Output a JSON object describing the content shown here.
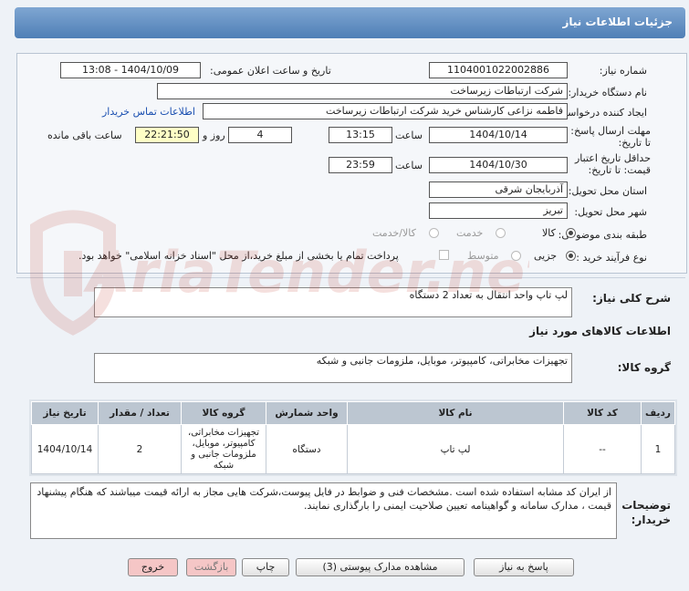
{
  "header": {
    "title": "جزئیات اطلاعات نیاز"
  },
  "form": {
    "need_number_label": "شماره نیاز:",
    "need_number": "1104001022002886",
    "announce_label": "تاریخ و ساعت اعلان عمومی:",
    "announce_value": "1404/10/09 - 13:08",
    "buyer_org_label": "نام دستگاه خریدار:",
    "buyer_org": "شرکت ارتباطات زیرساخت",
    "requester_label": "ایجاد کننده درخواست:",
    "requester": "فاطمه نزاعی کارشناس خرید شرکت ارتباطات زیرساخت",
    "contact_link": "اطلاعات تماس خریدار",
    "reply_deadline_label": "مهلت ارسال پاسخ: تا تاریخ:",
    "reply_date": "1404/10/14",
    "time_label": "ساعت",
    "reply_time": "13:15",
    "days_value": "4",
    "days_label": "روز و",
    "remaining_time": "22:21:50",
    "remaining_label": "ساعت باقی مانده",
    "price_validity_label": "حداقل تاریخ اعتبار قیمت: تا تاریخ:",
    "price_date": "1404/10/30",
    "price_time": "23:59",
    "province_label": "استان محل تحویل:",
    "province": "آذربایجان شرقی",
    "city_label": "شهر محل تحویل:",
    "city": "تبریز",
    "category_label": "طبقه بندی موضوعی:",
    "category_options": [
      "کالا",
      "خدمت",
      "کالا/خدمت"
    ],
    "process_label": "نوع فرآیند خرید :",
    "process_options": [
      "جزیی",
      "متوسط"
    ],
    "payment_note": "پرداخت تمام یا بخشی از مبلغ خرید،از محل \"اسناد خزانه اسلامی\" خواهد بود."
  },
  "need_desc": {
    "label": "شرح کلی نیاز:",
    "value": "لپ تاپ واحد انتقال به تعداد 2 دستگاه"
  },
  "goods_info": {
    "title": "اطلاعات کالاهای مورد نیاز",
    "group_label": "گروه کالا:",
    "group_value": "تجهیزات مخابراتی، کامپیوتر، موبایل، ملزومات جانبی و شبکه"
  },
  "items_table": {
    "headers": [
      "ردیف",
      "کد کالا",
      "نام کالا",
      "واحد شمارش",
      "گروه کالا",
      "تعداد / مقدار",
      "تاریخ نیاز"
    ],
    "rows": [
      [
        "1",
        "--",
        "لپ تاپ",
        "دستگاه",
        "تجهیزات مخابراتی، کامپیوتر، موبایل، ملزومات جانبی و شبکه",
        "2",
        "1404/10/14"
      ]
    ]
  },
  "buyer_notes": {
    "label": "توضیحات خریدار:",
    "value": "از ایران کد مشابه استفاده شده است .مشخصات فنی و ضوابط در فایل پیوست،شرکت هایی مجاز به ارائه قیمت میباشند که هنگام پیشنهاد قیمت ، مدارک سامانه و گواهینامه تعیین صلاحیت ایمنی را بارگذاری نمایند."
  },
  "buttons": {
    "reply": "پاسخ به نیاز",
    "attachments": "مشاهده مدارک پیوستی (3)",
    "print": "چاپ",
    "back": "بازگشت",
    "exit": "خروج"
  },
  "watermark": {
    "text": "AriaTender.net"
  }
}
